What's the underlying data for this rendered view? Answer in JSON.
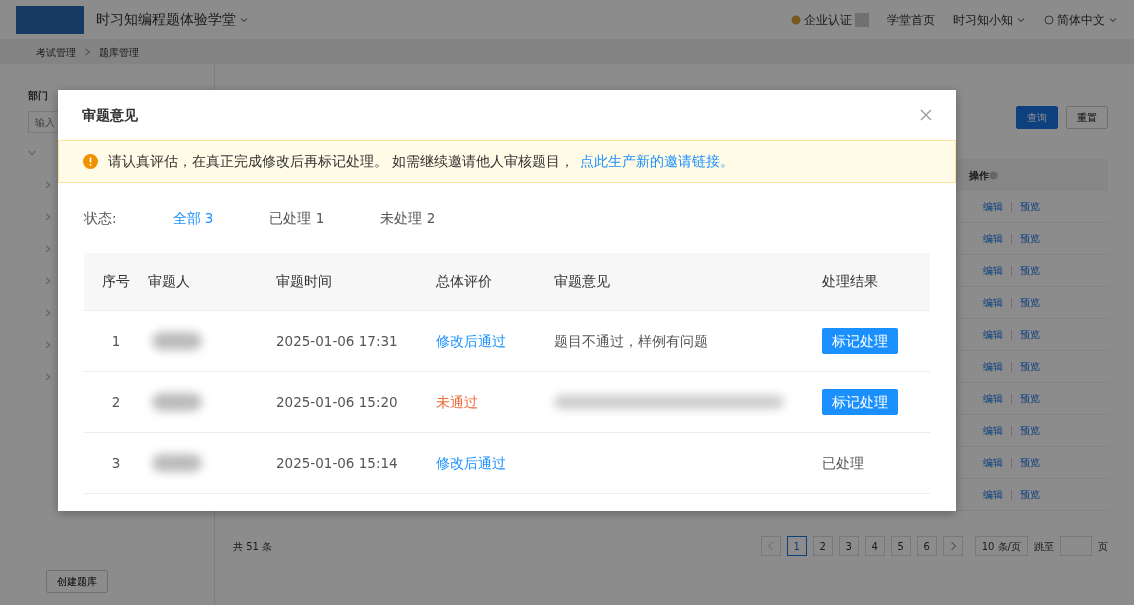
{
  "header": {
    "site_title": "时习知编程题体验学堂",
    "certification": "企业认证",
    "nav": [
      "学堂首页",
      "时习知小知",
      "简体中文"
    ]
  },
  "breadcrumb": [
    "考试管理",
    "题库管理"
  ],
  "sidebar": {
    "title": "部门",
    "search": {
      "placeholder": "输入"
    },
    "tree": [
      {
        "expanded": true
      },
      {
        "expanded": false
      },
      {
        "expanded": false
      },
      {
        "expanded": false
      },
      {
        "expanded": false
      },
      {
        "expanded": false
      },
      {
        "expanded": false
      },
      {
        "expanded": false
      }
    ],
    "create_button": "创建题库"
  },
  "toolbar": {
    "buttons": [
      {
        "label": "查询",
        "kind": "primary"
      },
      {
        "label": "重置",
        "kind": "default"
      }
    ]
  },
  "table": {
    "action_column": "操作",
    "rows": [
      [
        "编辑",
        "预览"
      ],
      [
        "编辑",
        "预览"
      ],
      [
        "编辑",
        "预览"
      ],
      [
        "编辑",
        "预览"
      ],
      [
        "编辑",
        "预览"
      ],
      [
        "编辑",
        "预览"
      ],
      [
        "编辑",
        "预览"
      ],
      [
        "编辑",
        "预览"
      ],
      [
        "编辑",
        "预览"
      ],
      [
        "编辑",
        "预览"
      ]
    ]
  },
  "pagination": {
    "total": "共 51 条",
    "pages": [
      {
        "label": "1",
        "selected": true
      },
      {
        "label": "2",
        "selected": false
      },
      {
        "label": "3",
        "selected": false
      },
      {
        "label": "4",
        "selected": false
      },
      {
        "label": "5",
        "selected": false
      },
      {
        "label": "6",
        "selected": false
      }
    ],
    "page_size": "10 条/页",
    "jump_label": "跳至",
    "page_unit": "页"
  },
  "dialog": {
    "title": "审题意见",
    "notice": {
      "text": "请认真评估，在真正完成修改后再标记处理。 如需继续邀请他人审核题目，",
      "link": "点此生产新的邀请链接。"
    },
    "status_label": "状态:",
    "filters": [
      {
        "label": "全部 3",
        "selected": true
      },
      {
        "label": "已处理 1",
        "selected": false
      },
      {
        "label": "未处理 2",
        "selected": false
      }
    ],
    "columns": [
      "序号",
      "审题人",
      "审题时间",
      "总体评价",
      "审题意见",
      "处理结果"
    ],
    "rows": [
      {
        "index": "1",
        "reviewer_blurred": true,
        "time": "2025-01-06 17:31",
        "verdict": {
          "text": "修改后通过",
          "kind": "pass"
        },
        "comment": "题目不通过，样例有问题",
        "comment_blurred": false,
        "result": {
          "kind": "button",
          "text": "标记处理"
        }
      },
      {
        "index": "2",
        "reviewer_blurred": true,
        "time": "2025-01-06 15:20",
        "verdict": {
          "text": "未通过",
          "kind": "fail"
        },
        "comment_blurred": true,
        "result": {
          "kind": "button",
          "text": "标记处理"
        }
      },
      {
        "index": "3",
        "reviewer_blurred": true,
        "time": "2025-01-06 15:14",
        "verdict": {
          "text": "修改后通过",
          "kind": "pass"
        },
        "comment_blurred": false,
        "result": {
          "kind": "text",
          "text": "已处理"
        }
      }
    ]
  }
}
